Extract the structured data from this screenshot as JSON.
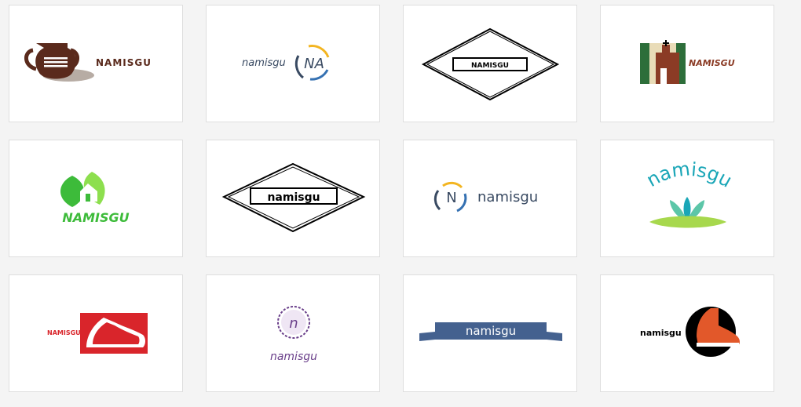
{
  "gallery": {
    "logos": [
      {
        "label": "NAMISGU",
        "style": "pottery"
      },
      {
        "label": "namisgu",
        "monogram": "NA",
        "style": "circle-monogram"
      },
      {
        "label": "NAMISGU",
        "style": "diamond-plaque"
      },
      {
        "label": "NAMISGU",
        "style": "church"
      },
      {
        "label": "NAMISGU",
        "style": "leaf-house"
      },
      {
        "label": "namisgu",
        "style": "diamond-plaque-large"
      },
      {
        "label": "namisgu",
        "monogram": "N",
        "style": "circle-initial"
      },
      {
        "label": "namisgu",
        "style": "arched-lotus"
      },
      {
        "label": "NAMISGU",
        "style": "sneaker-red"
      },
      {
        "label": "namisgu",
        "monogram": "n",
        "style": "stamp-badge"
      },
      {
        "label": "namisgu",
        "style": "ribbon-banner"
      },
      {
        "label": "namisgu",
        "style": "boot-circle"
      }
    ]
  },
  "colors": {
    "page_bg": "#f4f4f4",
    "card_bg": "#ffffff",
    "brown": "#5a2a1c",
    "green": "#3dbb3a",
    "teal": "#1aa6b7",
    "red": "#d9252b",
    "purple": "#6a3f8a",
    "navy": "#44618f",
    "orange": "#e2582a"
  },
  "icons": [
    "pottery-vase-icon",
    "circle-monogram-icon",
    "diamond-plaque-icon",
    "church-icon",
    "leaf-house-icon",
    "diamond-plaque-icon",
    "circle-initial-icon",
    "lotus-icon",
    "sneaker-icon",
    "stamp-badge-icon",
    "ribbon-banner-icon",
    "boot-icon"
  ]
}
